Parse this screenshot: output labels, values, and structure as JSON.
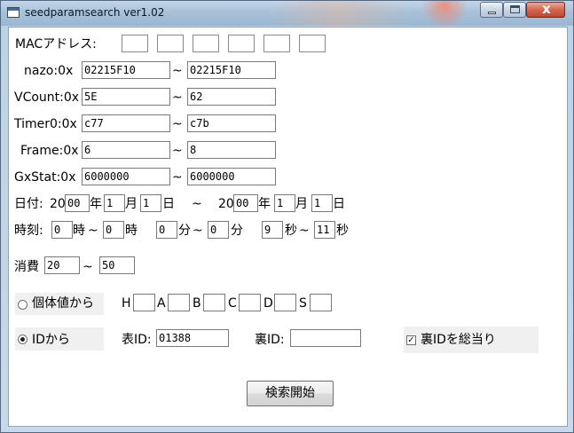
{
  "window": {
    "title": "seedparamsearch ver1.02",
    "close_glyph": "x",
    "icons": [
      "app-icon",
      "minimize-icon",
      "maximize-icon",
      "close-icon"
    ]
  },
  "mac": {
    "label": "MACアドレス:",
    "fields": [
      "",
      "",
      "",
      "",
      "",
      ""
    ]
  },
  "ranges": [
    {
      "label": "nazo:0x",
      "from": "02215F10",
      "to": "02215F10"
    },
    {
      "label": "VCount:0x",
      "from": "5E",
      "to": "62"
    },
    {
      "label": "Timer0:0x",
      "from": "c77",
      "to": "c7b"
    },
    {
      "label": "Frame:0x",
      "from": "6",
      "to": "8"
    },
    {
      "label": "GxStat:0x",
      "from": "6000000",
      "to": "6000000"
    }
  ],
  "tilde": "~",
  "date": {
    "label": "日付:",
    "century": "20",
    "from": {
      "year": "00",
      "month": "1",
      "day": "1"
    },
    "to": {
      "year": "00",
      "month": "1",
      "day": "1"
    },
    "year_unit": "年",
    "month_unit": "月",
    "day_unit": "日",
    "tilde": "~"
  },
  "time": {
    "label": "時刻:",
    "hour_from": "0",
    "hour_to": "0",
    "minute_from": "0",
    "minute_to": "0",
    "second_from": "9",
    "second_to": "11",
    "hour_unit": "時",
    "minute_unit": "分",
    "second_unit": "秒",
    "tilde": "~"
  },
  "consumption": {
    "label": "消費",
    "from": "20",
    "to": "50",
    "tilde": "~"
  },
  "mode_iv": {
    "label": "個体値から",
    "selected": false,
    "stats": [
      {
        "label": "H",
        "value": ""
      },
      {
        "label": "A",
        "value": ""
      },
      {
        "label": "B",
        "value": ""
      },
      {
        "label": "C",
        "value": ""
      },
      {
        "label": "D",
        "value": ""
      },
      {
        "label": "S",
        "value": ""
      }
    ]
  },
  "mode_id": {
    "label": "IDから",
    "selected": true,
    "tid_label": "表ID:",
    "tid_value": "01388",
    "sid_label": "裏ID:",
    "sid_value": "",
    "brute_sid_label": "裏IDを総当り",
    "brute_sid_checked": true,
    "check_glyph": "✓"
  },
  "search_button": "検索開始"
}
